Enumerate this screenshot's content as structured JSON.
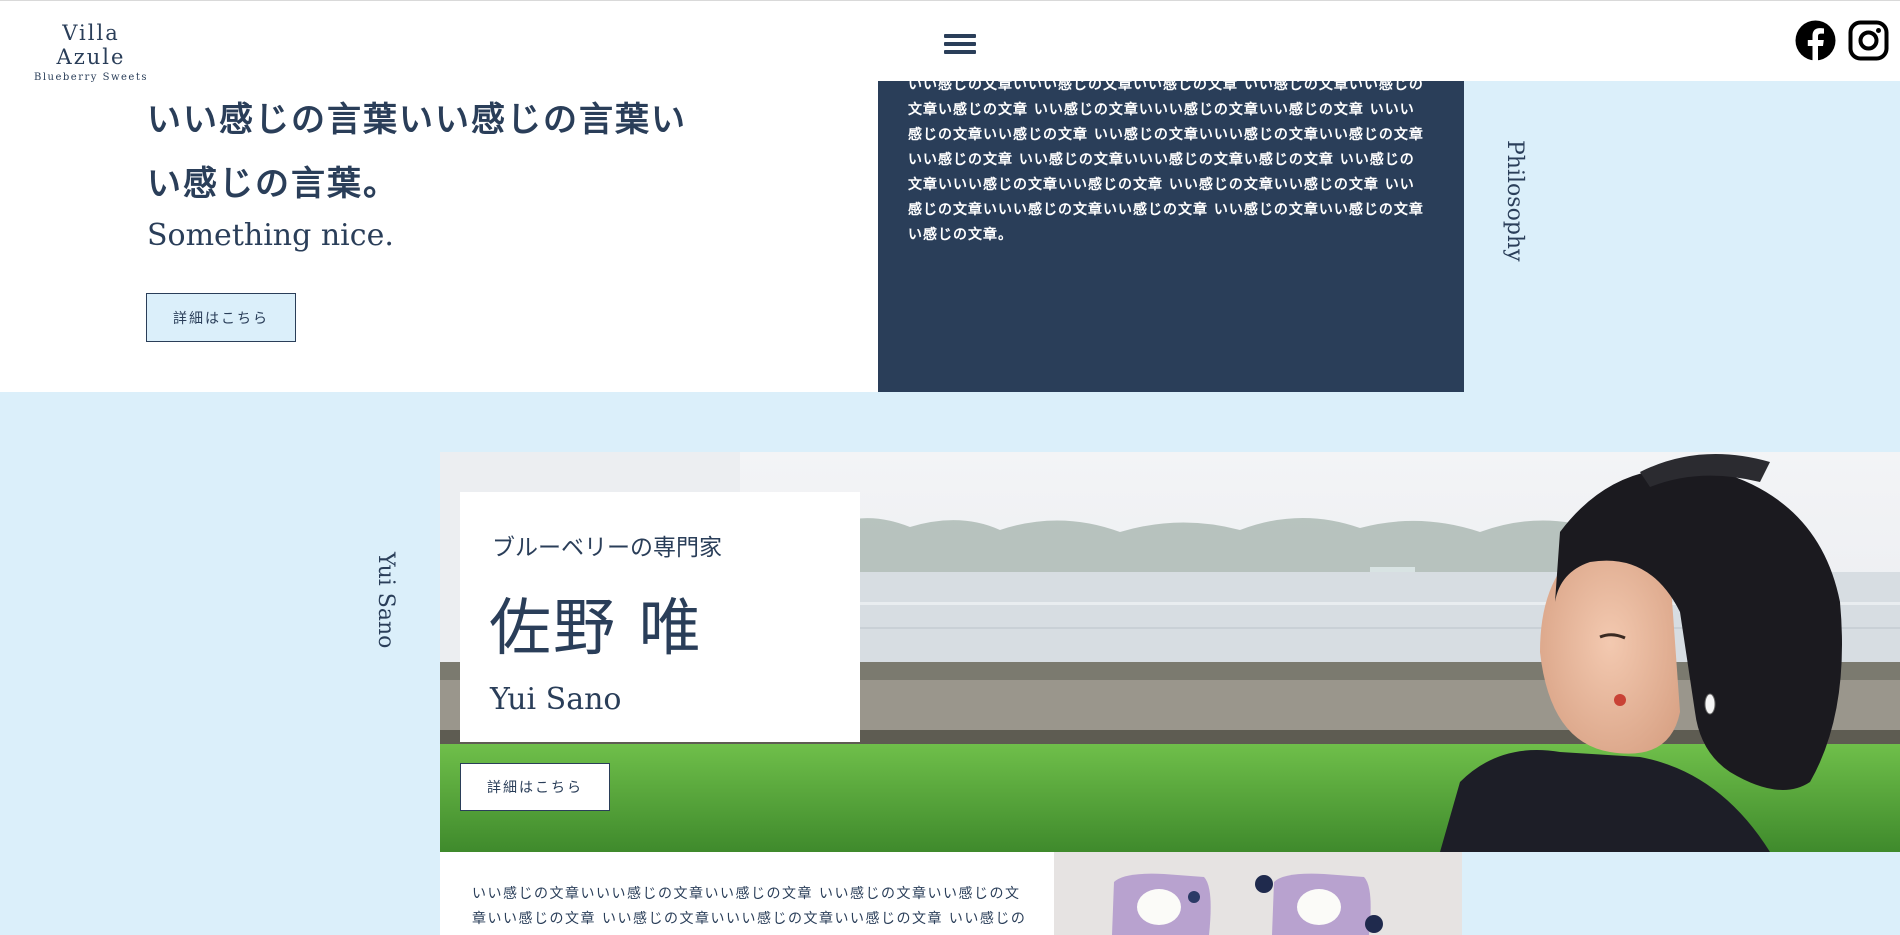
{
  "header": {
    "logo_name": "Villa Azule",
    "logo_sub": "Blueberry Sweets"
  },
  "hero": {
    "heading_line1": "いい感じの言葉いい感じの言葉い",
    "heading_line2": "い感じの言葉。",
    "subheading": "Something nice.",
    "button_label": "詳細はこちら"
  },
  "philosophy": {
    "label": "Philosophy",
    "body": "いい感じの文章いいい感じの文章いい感じの文章 いい感じの文章いい感じの文章い感じの文章 いい感じの文章いいい感じの文章いい感じの文章 いいい感じの文章いい感じの文章 いい感じの文章いいい感じの文章いい感じの文章 いい感じの文章 いい感じの文章いいい感じの文章い感じの文章 いい感じの文章いいい感じの文章いい感じの文章 いい感じの文章いい感じの文章 いい感じの文章いいい感じの文章いい感じの文章 いい感じの文章いい感じの文章い感じの文章。"
  },
  "profile": {
    "side_label": "Yui Sano",
    "subtitle": "ブルーベリーの専門家",
    "name_ja": "佐野 唯",
    "name_en": "Yui Sano",
    "button_label": "詳細はこちら",
    "body": "いい感じの文章いいい感じの文章いい感じの文章 いい感じの文章いい感じの文章いい感じの文章 いい感じの文章いいい感じの文章いい感じの文章 いい感じの文"
  },
  "colors": {
    "navy": "#2a3e59",
    "light_blue": "#dbeffa",
    "white": "#ffffff"
  },
  "icons": {
    "menu": "hamburger-icon",
    "facebook": "facebook-icon",
    "instagram": "instagram-icon"
  }
}
